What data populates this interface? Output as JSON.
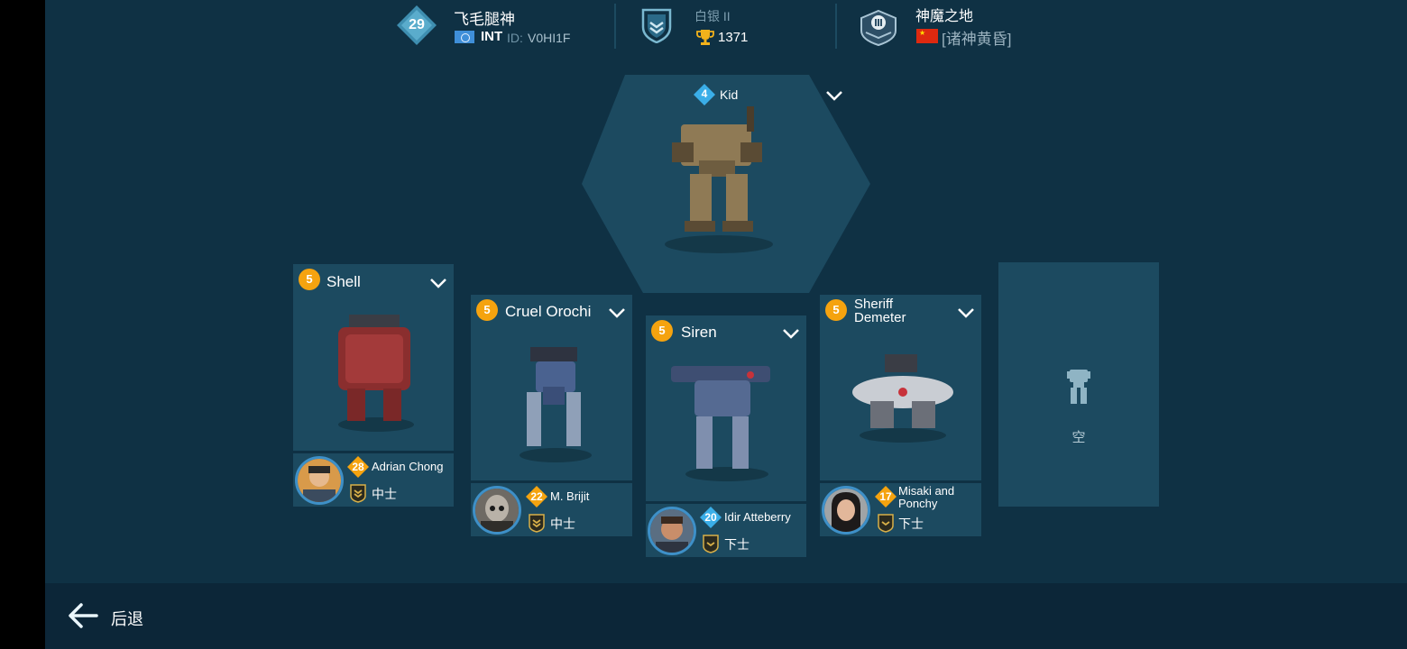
{
  "header": {
    "player": {
      "level": "29",
      "name": "飞毛腿神",
      "region": "INT",
      "id_label": "ID:",
      "id_value": "V0HI1F"
    },
    "league": {
      "name": "白银 II",
      "trophies": "1371"
    },
    "clan": {
      "name": "神魔之地",
      "tag": "[诸神黄昏]"
    }
  },
  "featured_robot": {
    "level": "4",
    "name": "Kid"
  },
  "hangar_slots": [
    {
      "robot_level": "5",
      "robot_name": "Shell",
      "pilot_level": "28",
      "pilot_name": "Adrian Chong",
      "pilot_rank": "中士"
    },
    {
      "robot_level": "5",
      "robot_name": "Cruel Orochi",
      "pilot_level": "22",
      "pilot_name": "M. Brijit",
      "pilot_rank": "中士"
    },
    {
      "robot_level": "5",
      "robot_name": "Siren",
      "pilot_level": "20",
      "pilot_name": "Idir Atteberry",
      "pilot_rank": "下士"
    },
    {
      "robot_level": "5",
      "robot_name_line1": "Sheriff",
      "robot_name_line2": "Demeter",
      "pilot_level": "17",
      "pilot_name_line1": "Misaki and",
      "pilot_name_line2": "Ponchy",
      "pilot_rank": "下士"
    },
    {
      "empty_label": "空"
    }
  ],
  "footer": {
    "back_label": "后退"
  },
  "colors": {
    "background": "#0f3144",
    "card": "#1c4a60",
    "accent_orange": "#f5a30f",
    "accent_blue": "#3aaee8"
  }
}
